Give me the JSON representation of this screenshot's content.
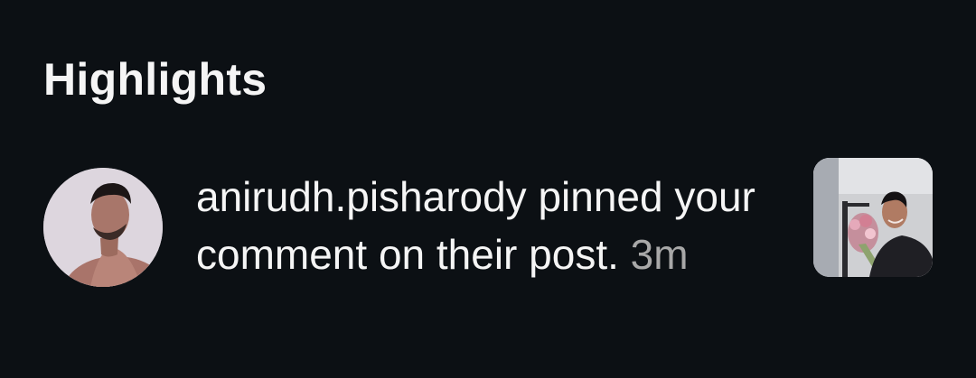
{
  "section": {
    "title": "Highlights"
  },
  "notification": {
    "username": "anirudh.pisharody",
    "message": " pinned your comment on their post.",
    "time": "3m",
    "avatar_icon": "profile-photo",
    "thumbnail_icon": "post-thumbnail"
  },
  "colors": {
    "background": "#0c1014",
    "primary_text": "#f5f5f5",
    "secondary_text": "#a8a8a8"
  }
}
